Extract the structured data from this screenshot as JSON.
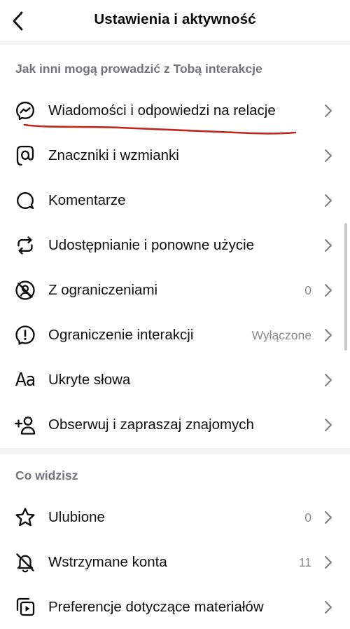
{
  "header": {
    "title": "Ustawienia i aktywność"
  },
  "sections": [
    {
      "header": "Jak inni mogą prowadzić z Tobą interakcje",
      "items": [
        {
          "label": "Wiadomości i odpowiedzi na relacje",
          "icon": "messenger-icon",
          "value": ""
        },
        {
          "label": "Znaczniki i wzmianki",
          "icon": "at-sign-icon",
          "value": ""
        },
        {
          "label": "Komentarze",
          "icon": "comment-icon",
          "value": ""
        },
        {
          "label": "Udostępnianie i ponowne użycie",
          "icon": "repost-icon",
          "value": ""
        },
        {
          "label": "Z ograniczeniami",
          "icon": "restricted-icon",
          "value": "0"
        },
        {
          "label": "Ograniczenie interakcji",
          "icon": "alert-icon",
          "value": "Wyłączone"
        },
        {
          "label": "Ukryte słowa",
          "icon": "text-aa-icon",
          "value": ""
        },
        {
          "label": "Obserwuj i zapraszaj znajomych",
          "icon": "add-person-icon",
          "value": ""
        }
      ]
    },
    {
      "header": "Co widzisz",
      "items": [
        {
          "label": "Ulubione",
          "icon": "star-icon",
          "value": "0"
        },
        {
          "label": "Wstrzymane konta",
          "icon": "muted-bell-icon",
          "value": "11"
        },
        {
          "label": "Preferencje dotyczące materiałów",
          "icon": "media-icon",
          "value": ""
        }
      ]
    }
  ],
  "icons": {
    "aa_glyph": "Aa"
  },
  "colors": {
    "annotation_underline": "#c0271c",
    "section_header": "#6f737a",
    "secondary_value": "#8a8d92",
    "separator": "#f3f3f4"
  }
}
